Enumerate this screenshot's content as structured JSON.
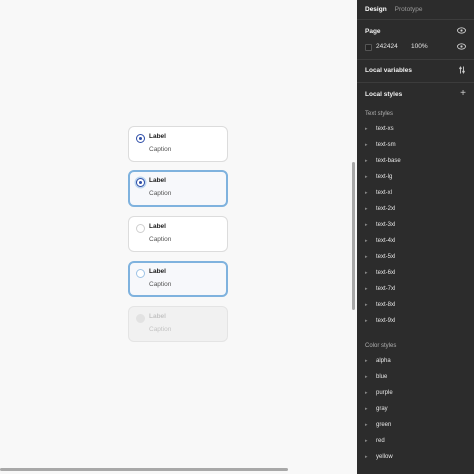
{
  "cards": [
    {
      "label": "Label",
      "caption": "Caption",
      "state": "checked"
    },
    {
      "label": "Label",
      "caption": "Caption",
      "state": "checked-focused"
    },
    {
      "label": "Label",
      "caption": "Caption",
      "state": "unchecked"
    },
    {
      "label": "Label",
      "caption": "Caption",
      "state": "unchecked-focused"
    },
    {
      "label": "Label",
      "caption": "Caption",
      "state": "disabled"
    }
  ],
  "panel": {
    "tabs": {
      "design": "Design",
      "prototype": "Prototype"
    },
    "page": {
      "title": "Page",
      "color": "242424",
      "opacity": "100%"
    },
    "local_variables": "Local variables",
    "local_styles": "Local styles",
    "text_styles_title": "Text styles",
    "text_styles": [
      "text-xs",
      "text-sm",
      "text-base",
      "text-lg",
      "text-xl",
      "text-2xl",
      "text-3xl",
      "text-4xl",
      "text-5xl",
      "text-6xl",
      "text-7xl",
      "text-8xl",
      "text-9xl"
    ],
    "color_styles_title": "Color styles",
    "color_styles": [
      "alpha",
      "blue",
      "purple",
      "gray",
      "green",
      "red",
      "yellow"
    ]
  },
  "colors": {
    "accent": "#2f4ea8",
    "focus": "#7fb2de",
    "panel_bg": "#2c2c2c"
  },
  "icons": {
    "page_visibility": "eye-icon",
    "variables": "sliders-icon",
    "add_style": "plus-icon",
    "style_caret": "caret-right-icon"
  }
}
